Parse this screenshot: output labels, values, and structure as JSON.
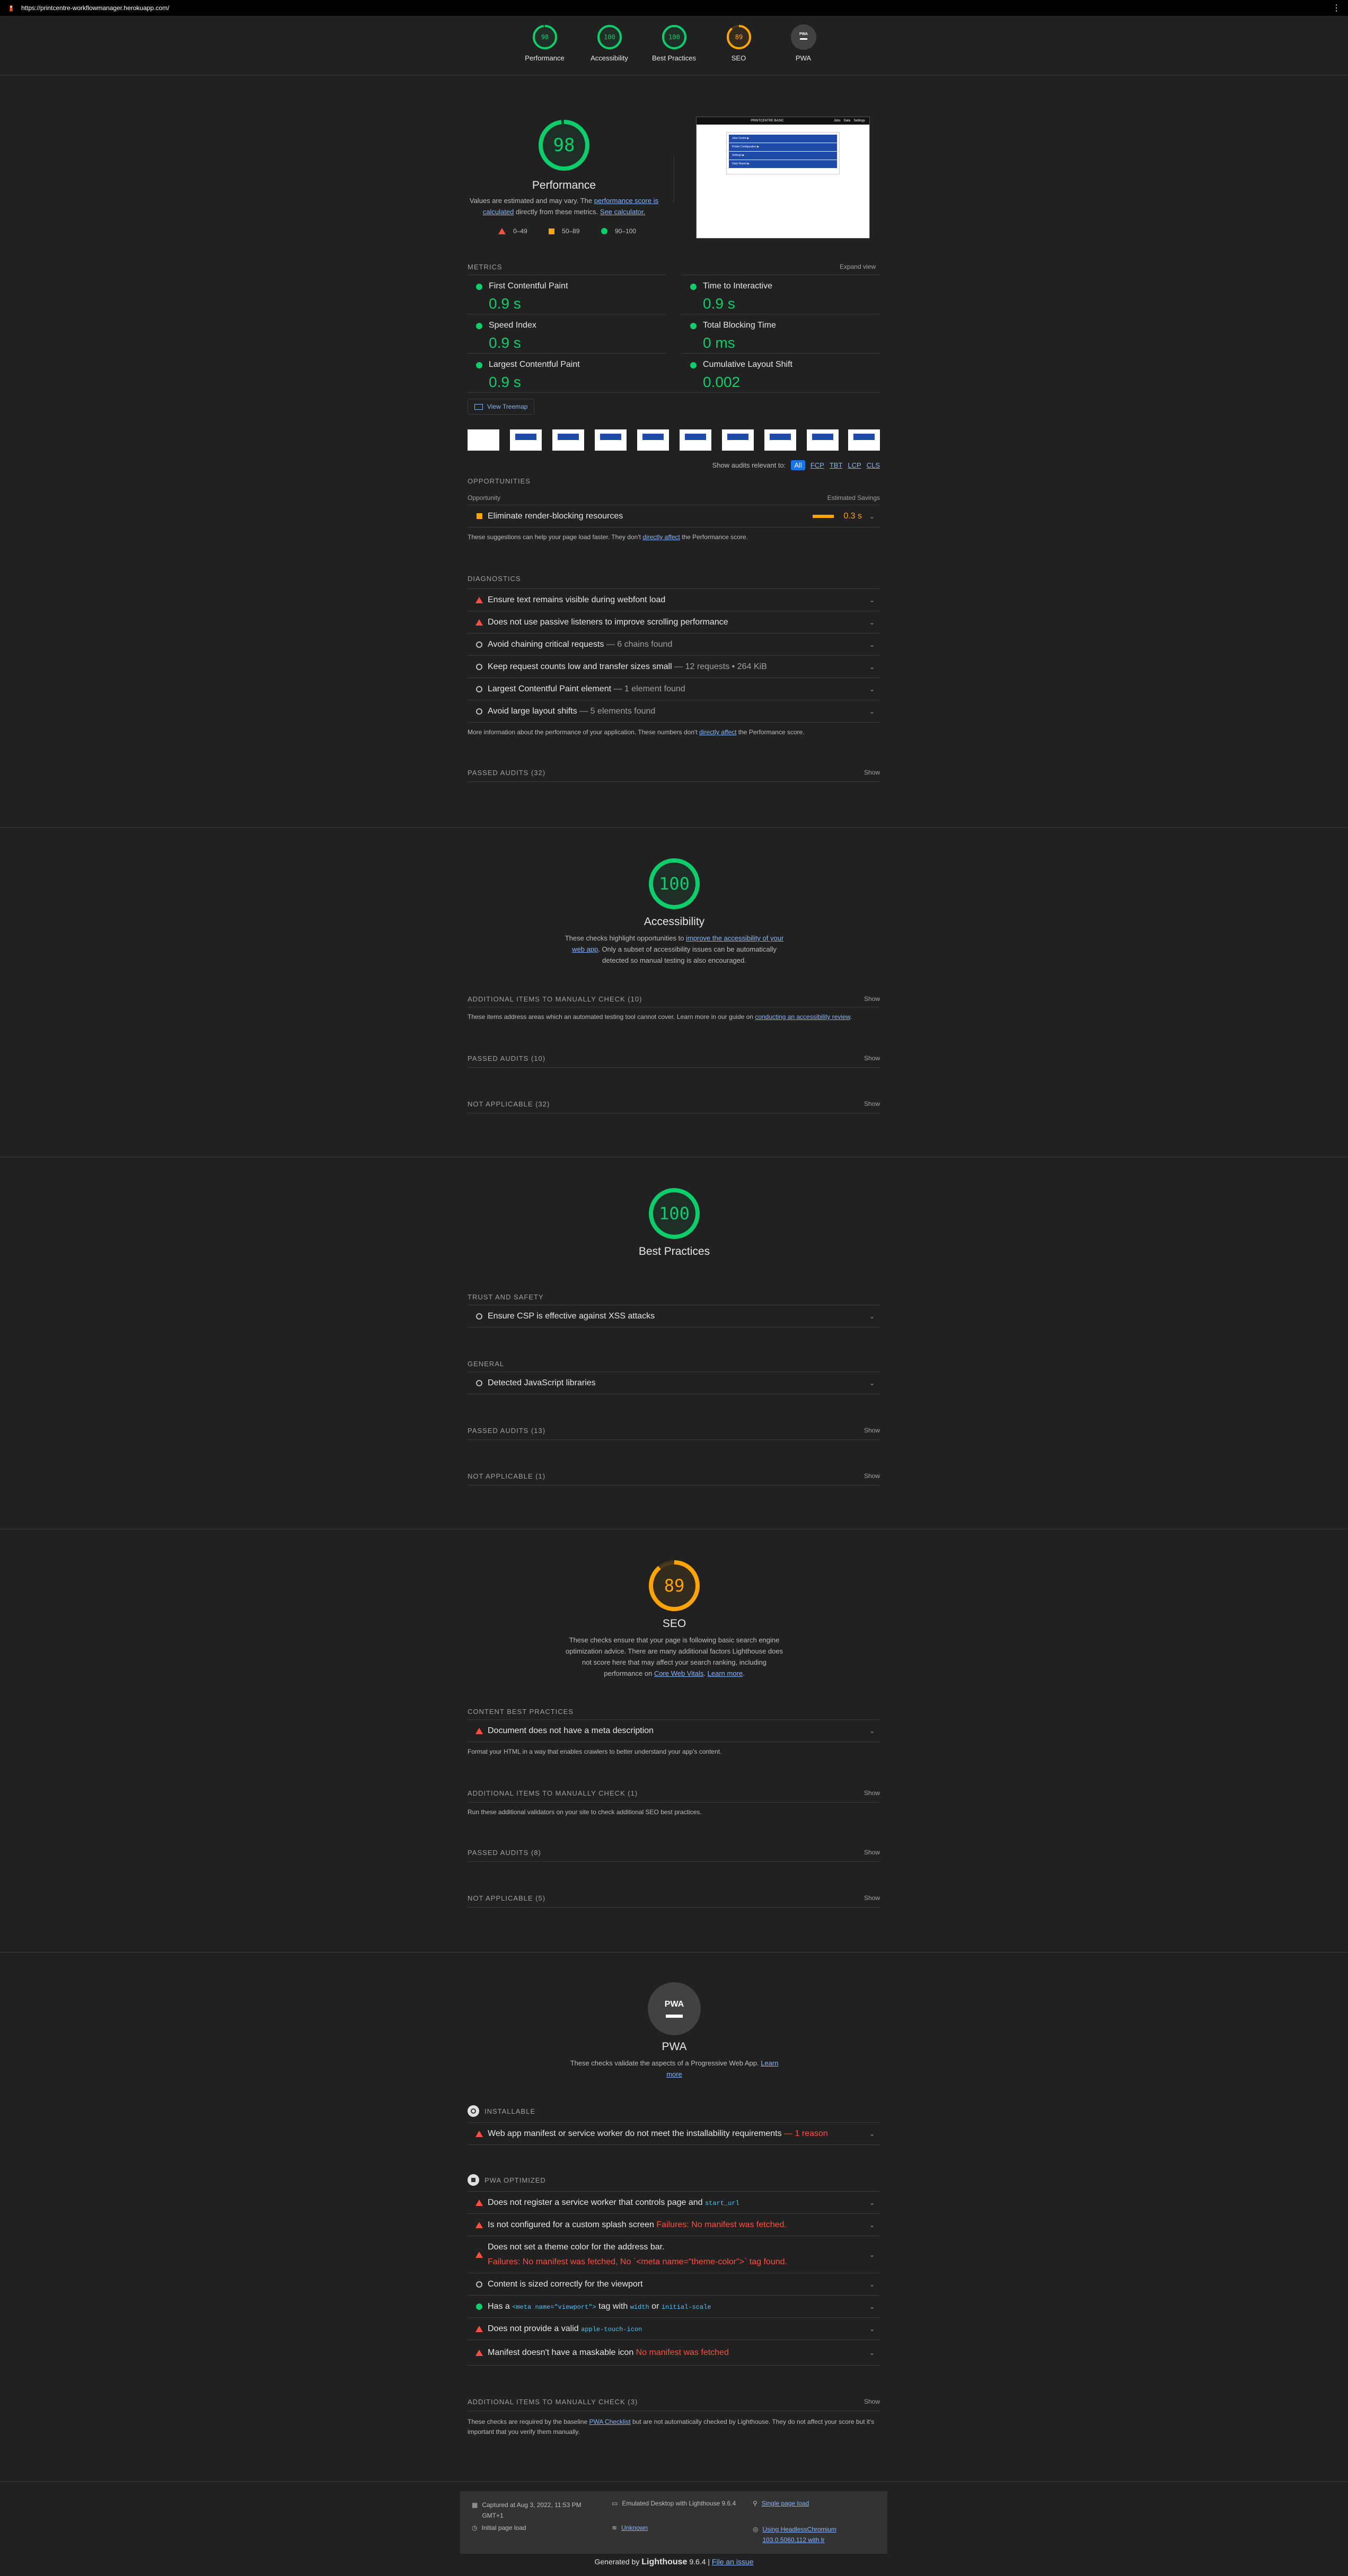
{
  "url": "https://printcentre-workflowmanager.herokuapp.com/",
  "colors": {
    "pass": "#0cce6b",
    "average": "#ffa400",
    "fail": "#ff4e42",
    "link": "#8ab4f8"
  },
  "nav": [
    {
      "label": "Performance",
      "score": "98",
      "value": 0.98,
      "color": "#0cce6b"
    },
    {
      "label": "Accessibility",
      "score": "100",
      "value": 1.0,
      "color": "#0cce6b"
    },
    {
      "label": "Best Practices",
      "score": "100",
      "value": 1.0,
      "color": "#0cce6b"
    },
    {
      "label": "SEO",
      "score": "89",
      "value": 0.89,
      "color": "#ffa400"
    },
    {
      "label": "PWA",
      "score": "PWA",
      "value": 0,
      "color": "#9e9e9e"
    }
  ],
  "performance": {
    "score": "98",
    "title": "Performance",
    "desc_pre": "Values are estimated and may vary. The ",
    "desc_link1": "performance score is calculated",
    "desc_mid": " directly from these metrics. ",
    "desc_link2": "See calculator.",
    "legend": [
      "0–49",
      "50–89",
      "90–100"
    ],
    "screenshot_title": "PRINTCENTRE BASIC",
    "screenshot_nav": [
      "Jobs",
      "Data",
      "Settings"
    ],
    "screenshot_rows": [
      "Jobs Centre ▶",
      "Printer Configuration ▶",
      "Settings ▶",
      "Daily Report ▶"
    ],
    "metrics_title": "Metrics",
    "expand": "Expand view",
    "metrics": [
      {
        "label": "First Contentful Paint",
        "value": "0.9 s"
      },
      {
        "label": "Time to Interactive",
        "value": "0.9 s"
      },
      {
        "label": "Speed Index",
        "value": "0.9 s"
      },
      {
        "label": "Total Blocking Time",
        "value": "0 ms"
      },
      {
        "label": "Largest Contentful Paint",
        "value": "0.9 s"
      },
      {
        "label": "Cumulative Layout Shift",
        "value": "0.002"
      }
    ],
    "treemap": "View Treemap",
    "filter_label": "Show audits relevant to:",
    "filters": [
      "All",
      "FCP",
      "TBT",
      "LCP",
      "CLS"
    ],
    "opportunities_title": "Opportunities",
    "opp_col1": "Opportunity",
    "opp_col2": "Estimated Savings",
    "opportunity": {
      "label": "Eliminate render-blocking resources",
      "saving": "0.3 s"
    },
    "opp_note_pre": "These suggestions can help your page load faster. They don't ",
    "opp_note_link": "directly affect",
    "opp_note_post": " the Performance score.",
    "diagnostics_title": "Diagnostics",
    "diagnostics": [
      {
        "label": "Ensure text remains visible during webfont load",
        "disp": "",
        "type": "fail"
      },
      {
        "label": "Does not use passive listeners to improve scrolling performance",
        "disp": "",
        "type": "fail"
      },
      {
        "label": "Avoid chaining critical requests",
        "disp": " — 6 chains found",
        "type": "info"
      },
      {
        "label": "Keep request counts low and transfer sizes small",
        "disp": " — 12 requests • 264 KiB",
        "type": "info"
      },
      {
        "label": "Largest Contentful Paint element",
        "disp": " — 1 element found",
        "type": "info"
      },
      {
        "label": "Avoid large layout shifts",
        "disp": " — 5 elements found",
        "type": "info"
      }
    ],
    "diag_note_pre": "More information about the performance of your application. These numbers don't ",
    "diag_note_link": "directly affect",
    "diag_note_post": " the Performance score.",
    "passed": "Passed audits (32)",
    "show": "Show"
  },
  "accessibility": {
    "score": "100",
    "title": "Accessibility",
    "desc_pre": "These checks highlight opportunities to ",
    "desc_link": "improve the accessibility of your web app",
    "desc_post": ". Only a subset of accessibility issues can be automatically detected so manual testing is also encouraged.",
    "manual": "Additional items to manually check (10)",
    "manual_note_pre": "These items address areas which an automated testing tool cannot cover. Learn more in our guide on ",
    "manual_note_link": "conducting an accessibility review",
    "manual_note_post": ".",
    "passed": "Passed audits (10)",
    "na": "Not applicable (32)",
    "show": "Show"
  },
  "best_practices": {
    "score": "100",
    "title": "Best Practices",
    "trust": "Trust and Safety",
    "csp": "Ensure CSP is effective against XSS attacks",
    "general": "General",
    "libs": "Detected JavaScript libraries",
    "passed": "Passed audits (13)",
    "na": "Not applicable (1)",
    "show": "Show"
  },
  "seo": {
    "score": "89",
    "title": "SEO",
    "desc_pre": "These checks ensure that your page is following basic search engine optimization advice. There are many additional factors Lighthouse does not score here that may affect your search ranking, including performance on ",
    "desc_link1": "Core Web Vitals",
    "desc_mid": ". ",
    "desc_link2": "Learn more",
    "desc_post": ".",
    "content": "Content Best Practices",
    "meta": "Document does not have a meta description",
    "content_note": "Format your HTML in a way that enables crawlers to better understand your app's content.",
    "manual": "Additional items to manually check (1)",
    "manual_note": "Run these additional validators on your site to check additional SEO best practices.",
    "passed": "Passed audits (8)",
    "na": "Not applicable (5)",
    "show": "Show"
  },
  "pwa": {
    "badge": "PWA",
    "title": "PWA",
    "desc_pre": "These checks validate the aspects of a Progressive Web App. ",
    "desc_link": "Learn more",
    "installable": "Installable",
    "install_audit": "Web app manifest or service worker do not meet the installability requirements",
    "install_disp": " — 1 reason",
    "optimized": "PWA Optimized",
    "audits": [
      {
        "pre": "Does not register a service worker that controls page and ",
        "code": "start_url",
        "post": "",
        "fail": "",
        "type": "fail"
      },
      {
        "pre": "Is not configured for a custom splash screen ",
        "code": "",
        "post": "",
        "fail": "Failures: No manifest was fetched.",
        "type": "fail"
      },
      {
        "pre": "Does not set a theme color for the address bar.",
        "code": "",
        "post": "",
        "fail": "Failures: No manifest was fetched, No `<meta name=\"theme-color\">` tag found.",
        "type": "fail"
      },
      {
        "pre": "Content is sized correctly for the viewport",
        "code": "",
        "post": "",
        "fail": "",
        "type": "info"
      },
      {
        "pre": "Has a ",
        "code": "<meta name=\"viewport\">",
        "post": " tag with ",
        "fail": "",
        "type": "pass"
      },
      {
        "pre": "Does not provide a valid ",
        "code": "apple-touch-icon",
        "post": "",
        "fail": "",
        "type": "fail"
      },
      {
        "pre": "Manifest doesn't have a maskable icon ",
        "code": "",
        "post": "",
        "fail": "No manifest was fetched",
        "type": "fail"
      }
    ],
    "viewport_code2": "width",
    "viewport_or": " or ",
    "viewport_code3": "initial-scale",
    "manual": "Additional items to manually check (3)",
    "manual_note_pre": "These checks are required by the baseline ",
    "manual_note_link": "PWA Checklist",
    "manual_note_post": " but are not automatically checked by Lighthouse. They do not affect your score but it's important that you verify them manually.",
    "show": "Show"
  },
  "footer": {
    "captured": "Captured at Aug 3, 2022, 11:53 PM GMT+1",
    "initial": "Initial page load",
    "emulated": "Emulated Desktop with Lighthouse 9.6.4",
    "throttle": "Unknown",
    "single": "Single page load",
    "browser": "Using HeadlessChromium 103.0.5060.112 with lr",
    "generated_pre": "Generated by ",
    "generated_brand": "Lighthouse",
    "generated_ver": " 9.6.4 | ",
    "generated_link": "File an issue"
  }
}
